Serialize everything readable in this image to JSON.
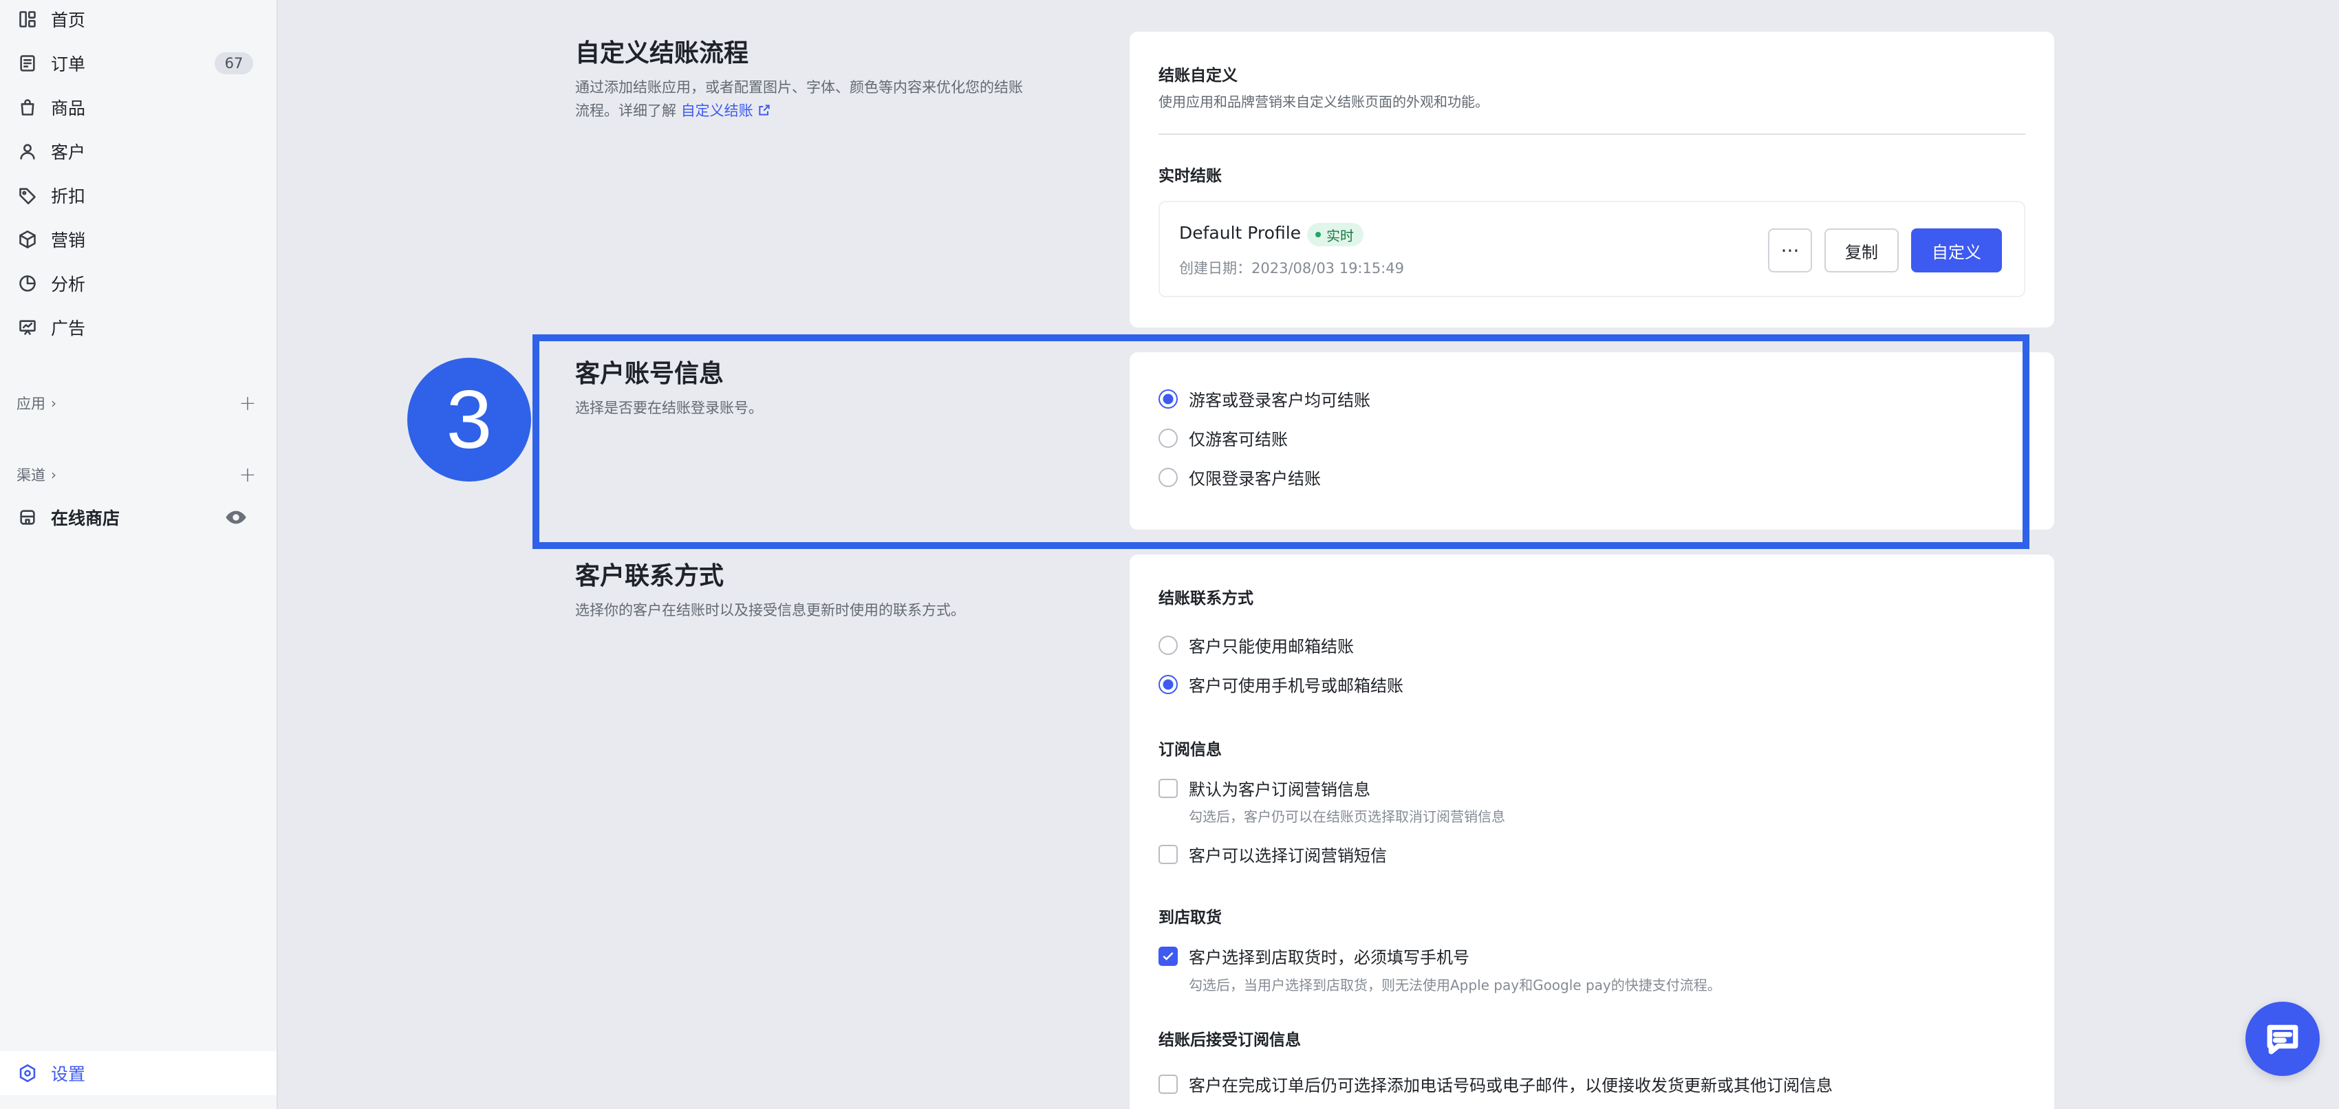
{
  "sidebar": {
    "items": [
      {
        "label": "首页",
        "icon": "home-icon"
      },
      {
        "label": "订单",
        "icon": "orders-icon",
        "badge": "67"
      },
      {
        "label": "商品",
        "icon": "products-icon"
      },
      {
        "label": "客户",
        "icon": "customer-icon"
      },
      {
        "label": "折扣",
        "icon": "discount-tag-icon"
      },
      {
        "label": "营销",
        "icon": "marketing-cube-icon"
      },
      {
        "label": "分析",
        "icon": "analytics-pie-icon"
      },
      {
        "label": "广告",
        "icon": "ads-board-icon"
      }
    ],
    "apps_label": "应用",
    "channels_label": "渠道",
    "online_store_label": "在线商店",
    "settings_label": "设置"
  },
  "sections": {
    "checkout_customize": {
      "title": "自定义结账流程",
      "desc_line1": "通过添加结账应用，或者配置图片、字体、颜色等内容来优化您的结账",
      "desc_line2": "流程。详细了解",
      "link": "自定义结账",
      "card_title": "结账自定义",
      "card_desc": "使用应用和品牌营销来自定义结账页面的外观和功能。",
      "live_title": "实时结账",
      "profile_name": "Default Profile",
      "live_badge": "实时",
      "created": "创建日期：2023/08/03 19:15:49",
      "more_btn": "···",
      "copy_btn": "复制",
      "customize_btn": "自定义"
    },
    "account": {
      "title": "客户账号信息",
      "desc": "选择是否要在结账登录账号。",
      "options": [
        "游客或登录客户均可结账",
        "仅游客可结账",
        "仅限登录客户结账"
      ],
      "selected": 0
    },
    "contact": {
      "title": "客户联系方式",
      "desc": "选择你的客户在结账时以及接受信息更新时使用的联系方式。",
      "method_title": "结账联系方式",
      "method_options": [
        "客户只能使用邮箱结账",
        "客户可使用手机号或邮箱结账"
      ],
      "method_selected": 1,
      "sub_title": "订阅信息",
      "sub_default": "默认为客户订阅营销信息",
      "sub_default_hint": "勾选后，客户仍可以在结账页选择取消订阅营销信息",
      "sub_sms": "客户可以选择订阅营销短信",
      "pickup_title": "到店取货",
      "pickup_option": "客户选择到店取货时，必须填写手机号",
      "pickup_hint": "勾选后，当用户选择到店取货，则无法使用Apple pay和Google pay的快捷支付流程。",
      "after_title": "结账后接受订阅信息",
      "after_option": "客户在完成订单后仍可选择添加电话号码或电子邮件，以便接收发货更新或其他订阅信息"
    }
  },
  "annotation": {
    "step": "3",
    "color": "#2f62e8"
  },
  "colors": {
    "accent": "#3d5af1",
    "live_badge_bg": "#e1f6ea"
  }
}
